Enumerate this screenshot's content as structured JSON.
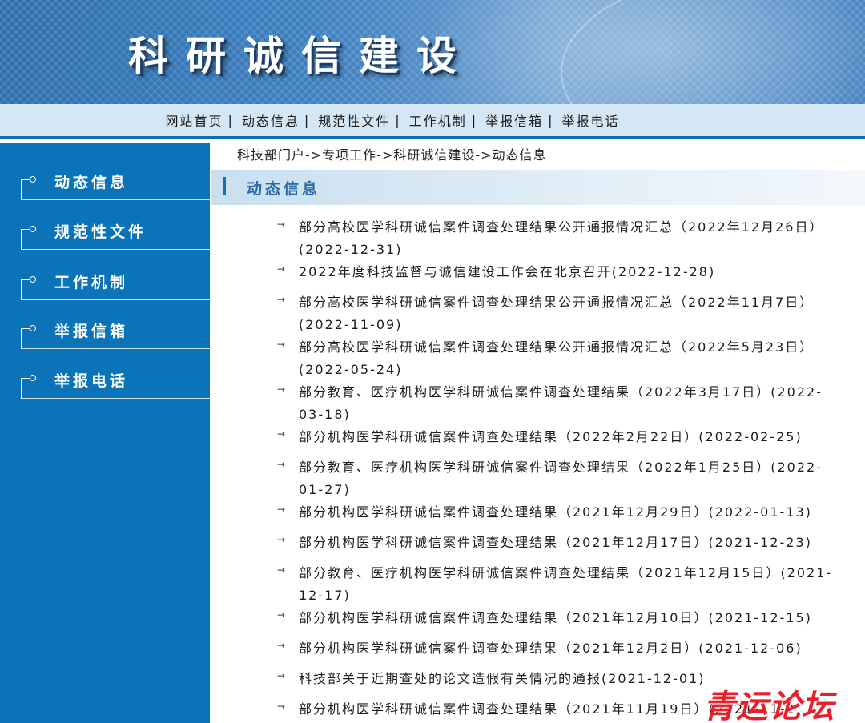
{
  "banner": {
    "title": "科研诚信建设"
  },
  "topnav": {
    "items": [
      "网站首页",
      "动态信息",
      "规范性文件",
      "工作机制",
      "举报信箱",
      "举报电话"
    ],
    "separator": "|"
  },
  "sidebar": {
    "items": [
      "动态信息",
      "规范性文件",
      "工作机制",
      "举报信箱",
      "举报电话"
    ]
  },
  "breadcrumb": "科技部门户->专项工作->科研诚信建设->动态信息",
  "section": {
    "title": "动态信息"
  },
  "news": [
    {
      "arrow": "→",
      "text": "部分高校医学科研诚信案件调查处理结果公开通报情况汇总（2022年12月26日）\n(2022-12-31)"
    },
    {
      "arrow": "→",
      "text": "2022年度科技监督与诚信建设工作会在北京召开(2022-12-28)"
    },
    {
      "arrow": "→",
      "text": "部分高校医学科研诚信案件调查处理结果公开通报情况汇总（2022年11月7日）\n(2022-11-09)"
    },
    {
      "arrow": "→",
      "text": "部分高校医学科研诚信案件调查处理结果公开通报情况汇总（2022年5月23日）\n(2022-05-24)"
    },
    {
      "arrow": "→",
      "text": "部分教育、医疗机构医学科研诚信案件调查处理结果（2022年3月17日）(2022-\n03-18)"
    },
    {
      "arrow": "→",
      "text": "部分机构医学科研诚信案件调查处理结果（2022年2月22日）(2022-02-25)"
    },
    {
      "arrow": "→",
      "text": "部分教育、医疗机构医学科研诚信案件调查处理结果（2022年1月25日）(2022-\n01-27)"
    },
    {
      "arrow": "→",
      "text": "部分机构医学科研诚信案件调查处理结果（2021年12月29日）(2022-01-13)"
    },
    {
      "arrow": "→",
      "text": "部分机构医学科研诚信案件调查处理结果（2021年12月17日）(2021-12-23)"
    },
    {
      "arrow": "→",
      "text": "部分教育、医疗机构医学科研诚信案件调查处理结果（2021年12月15日）(2021-\n12-17)"
    },
    {
      "arrow": "→",
      "text": "部分机构医学科研诚信案件调查处理结果（2021年12月10日）(2021-12-15)"
    },
    {
      "arrow": "→",
      "text": "部分机构医学科研诚信案件调查处理结果（2021年12月2日）(2021-12-06)"
    },
    {
      "arrow": "→",
      "text": "科技部关于近期查处的论文造假有关情况的通报(2021-12-01)"
    },
    {
      "arrow": "→",
      "text": "部分机构医学科研诚信案件调查处理结果（2021年11月19日）(2021-11-2"
    }
  ],
  "watermark": "青运论坛"
}
